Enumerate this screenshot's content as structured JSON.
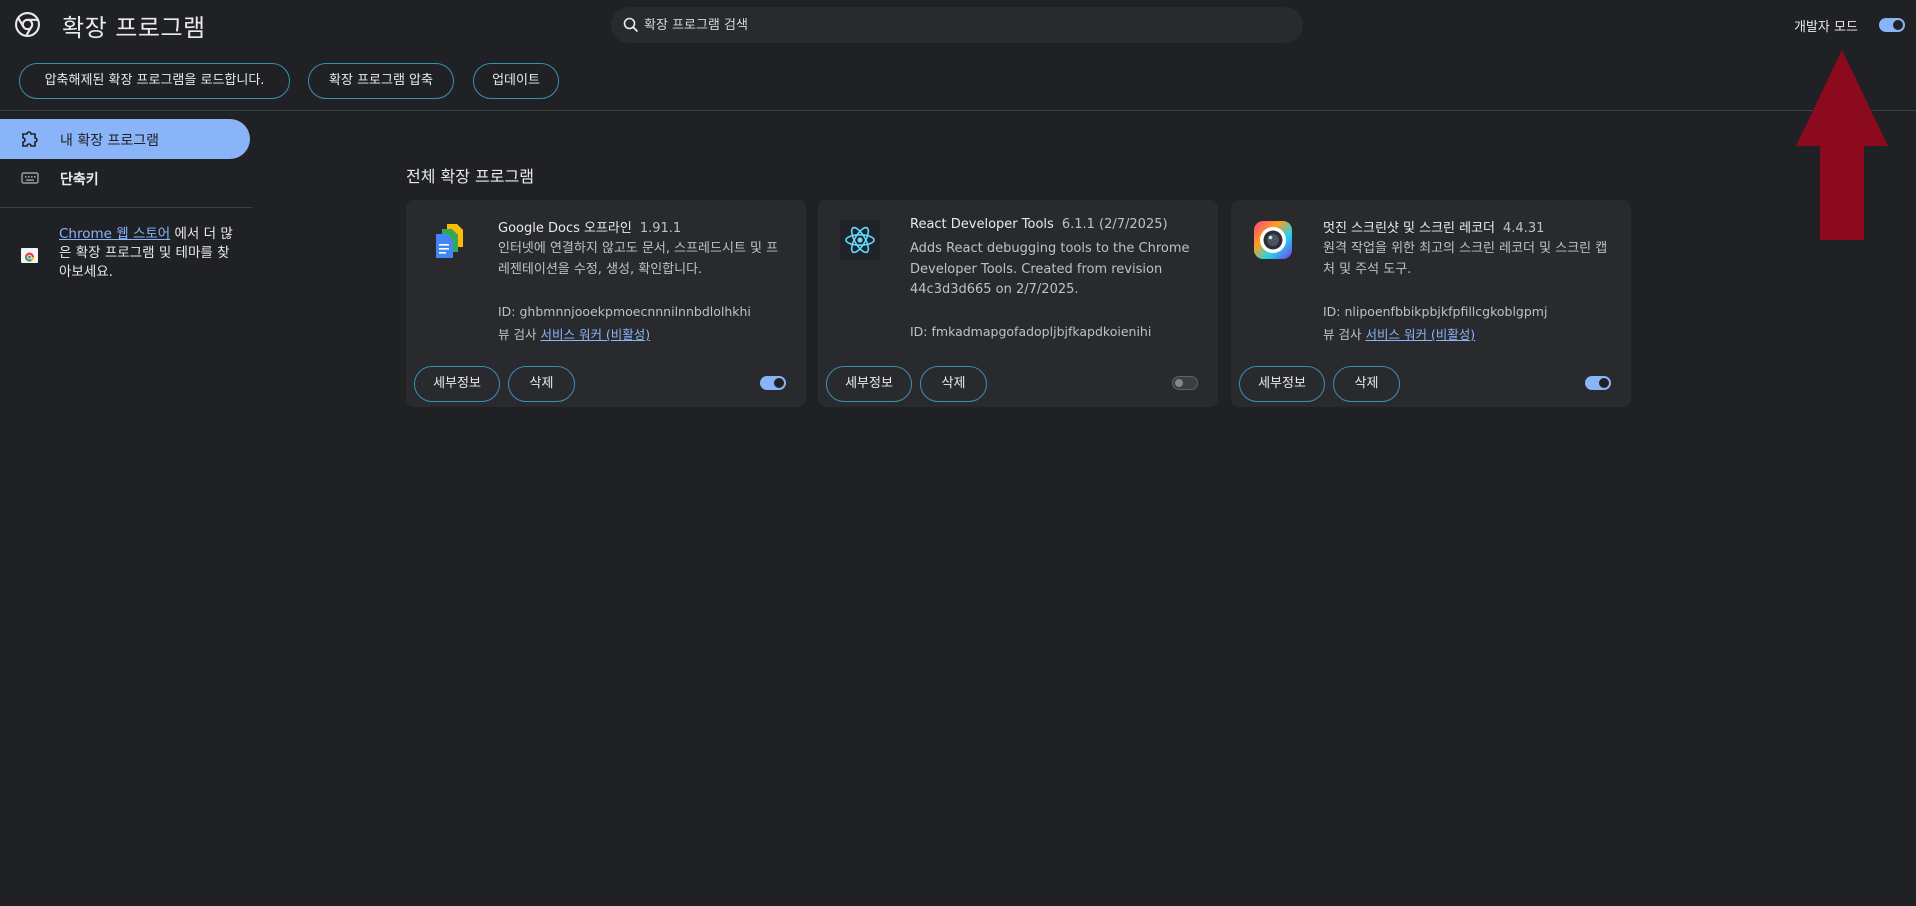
{
  "header": {
    "title": "확장 프로그램",
    "search_placeholder": "확장 프로그램 검색",
    "dev_mode_label": "개발자 모드",
    "dev_mode_on": true
  },
  "toolbar": {
    "load_unpacked": "압축해제된 확장 프로그램을 로드합니다.",
    "pack": "확장 프로그램 압축",
    "update": "업데이트"
  },
  "sidebar": {
    "items": [
      {
        "label": "내 확장 프로그램",
        "icon": "extension-puzzle-icon",
        "active": true
      },
      {
        "label": "단축키",
        "icon": "keyboard-icon",
        "active": false
      }
    ],
    "store_link": "Chrome 웹 스토어",
    "store_text": "에서 더 많은 확장 프로그램 및 테마를 찾아보세요."
  },
  "main": {
    "section_title": "전체 확장 프로그램",
    "details_label": "세부정보",
    "remove_label": "삭제",
    "extensions": [
      {
        "name": "Google Docs 오프라인",
        "version": "1.91.1",
        "description": "인터넷에 연결하지 않고도 문서, 스프레드시트 및 프레젠테이션을 수정, 생성, 확인합니다.",
        "id": "ID: ghbmnnjooekpmoecnnnilnnbdlolhkhi",
        "inspect_prefix": "뷰 검사",
        "inspect_link": "서비스 워커 (비활성)",
        "enabled": true,
        "icon": "google-docs-icon"
      },
      {
        "name": "React Developer Tools",
        "version": "6.1.1 (2/7/2025)",
        "description": "Adds React debugging tools to the Chrome Developer Tools. Created from revision 44c3d3d665 on 2/7/2025.",
        "id": "ID: fmkadmapgofadopljbjfkapdkoienihi",
        "enabled": false,
        "icon": "react-icon"
      },
      {
        "name": "멋진 스크린샷 및 스크린 레코더",
        "version": "4.4.31",
        "description": "원격 작업을 위한 최고의 스크린 레코더 및 스크린 캡처 및 주석 도구.",
        "id": "ID: nlipoenfbbikpbjkfpfillcgkoblgpmj",
        "inspect_prefix": "뷰 검사",
        "inspect_link": "서비스 워커 (비활성)",
        "enabled": true,
        "icon": "camera-lens-icon"
      }
    ]
  },
  "colors": {
    "background": "#202124",
    "accent": "#8ab4f8",
    "card": "#292a2d",
    "annotation_arrow": "#8b0a1e"
  }
}
